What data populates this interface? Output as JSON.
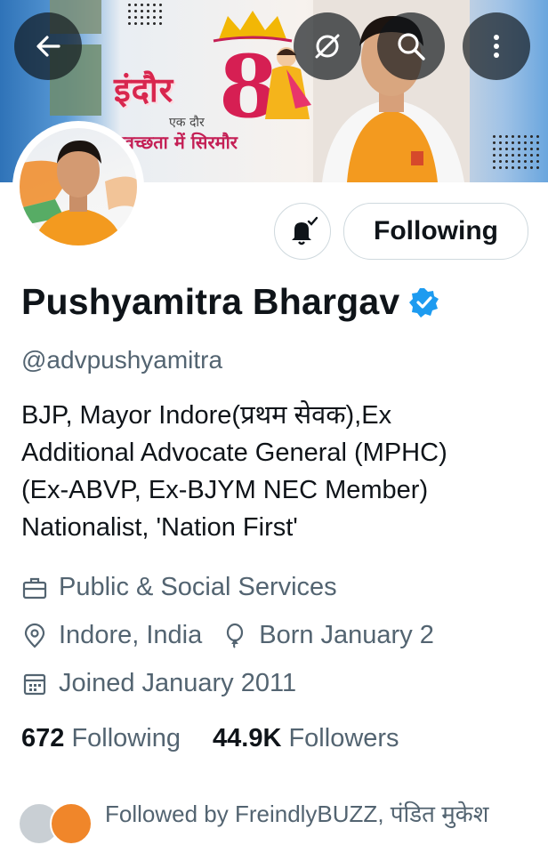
{
  "colors": {
    "accent": "#1d9bf0",
    "text_primary": "#0f1419",
    "text_secondary": "#536471",
    "border": "#cfd9de"
  },
  "banner": {
    "title_hindi": "इंदौर",
    "number": "8",
    "tagline_1": "एक दौर",
    "tagline_2": "स्वच्छता में सिरमौर"
  },
  "top_actions": [
    {
      "icon": "back-arrow-icon"
    },
    {
      "icon": "mute-icon"
    },
    {
      "icon": "search-icon"
    },
    {
      "icon": "more-vertical-icon"
    }
  ],
  "actions": {
    "notify_icon": "bell-subscribed-icon",
    "follow_label": "Following"
  },
  "profile": {
    "name": "Pushyamitra Bhargav",
    "verified": true,
    "handle": "@advpushyamitra",
    "bio_lines": [
      "BJP, Mayor Indore(प्रथम सेवक),Ex",
      "Additional Advocate General (MPHC)",
      "(Ex-ABVP, Ex-BJYM NEC Member)",
      "Nationalist, 'Nation First'"
    ],
    "category": "Public & Social Services",
    "location": "Indore, India",
    "birthday": "Born January 2",
    "joined": "Joined January 2011",
    "following_count": "672",
    "following_label": "Following",
    "followers_count": "44.9K",
    "followers_label": "Followers",
    "followed_by": "Followed by FreindlyBUZZ, पंडित मुकेश"
  }
}
